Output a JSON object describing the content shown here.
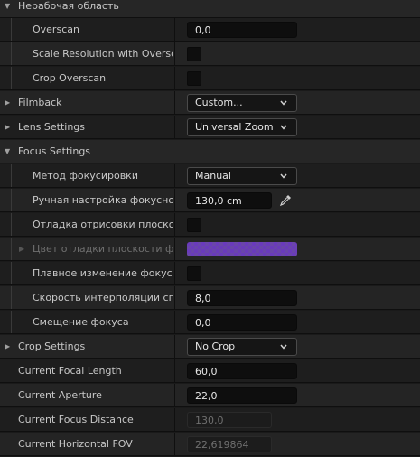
{
  "sections": {
    "overscan_section": "Нерабочая область",
    "filmback": "Filmback",
    "lens_settings": "Lens Settings",
    "focus_settings": "Focus Settings",
    "crop_settings": "Crop Settings"
  },
  "props": {
    "overscan": {
      "label": "Overscan",
      "value": "0,0"
    },
    "scale_resolution": {
      "label": "Scale Resolution with Overscan"
    },
    "crop_overscan": {
      "label": "Crop Overscan"
    },
    "filmback_value": "Custom...",
    "lens_value": "Universal Zoom",
    "focus_method": {
      "label": "Метод фокусировки",
      "value": "Manual"
    },
    "manual_focus": {
      "label": "Ручная настройка фокусного расстояния",
      "value": "130,0 cm"
    },
    "debug_draw_plane": {
      "label": "Отладка отрисовки плоскости фокуса"
    },
    "debug_plane_color": {
      "label": "Цвет отладки плоскости фокуса"
    },
    "smooth_focus": {
      "label": "Плавное изменение фокуса"
    },
    "interp_speed": {
      "label": "Скорость интерполяции сглаживания",
      "value": "8,0"
    },
    "focus_offset": {
      "label": "Смещение фокуса",
      "value": "0,0"
    },
    "crop_value": "No Crop",
    "current_focal_length": {
      "label": "Current Focal Length",
      "value": "60,0"
    },
    "current_aperture": {
      "label": "Current Aperture",
      "value": "22,0"
    },
    "current_focus_distance": {
      "label": "Current Focus Distance",
      "value": "130,0"
    },
    "current_hfov": {
      "label": "Current Horizontal FOV",
      "value": "22,619864"
    }
  },
  "icons": {
    "expand_open": "triangle-down-icon",
    "expand_closed": "triangle-right-icon",
    "combo": "chevron-down-icon",
    "pipette": "eyedropper-icon"
  },
  "colors": {
    "debug_plane_color": "#6a3fc0"
  }
}
